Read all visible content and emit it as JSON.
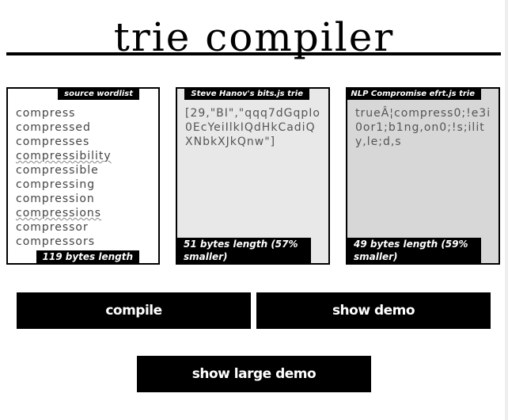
{
  "page": {
    "title": "trie compiler"
  },
  "panels": {
    "source": {
      "tag": "source wordlist",
      "words": [
        {
          "text": "compress"
        },
        {
          "text": "compressed"
        },
        {
          "text": "compresses"
        },
        {
          "text": "compressibility"
        },
        {
          "text": "compressible"
        },
        {
          "text": "compressing"
        },
        {
          "text": "compression"
        },
        {
          "text": "compressions"
        },
        {
          "text": "compressor"
        },
        {
          "text": "compressors"
        }
      ],
      "footer": "119 bytes length"
    },
    "bits": {
      "tag": "Steve Hanov's bits.js trie",
      "output": "[29,\"BI\",\"qqq7dGqpIo0EcYeiIlkIQdHkCadiQXNbkXJkQnw\"]",
      "footer": "51 bytes length (57% smaller)"
    },
    "efrt": {
      "tag": "NLP Compromise efrt.js trie",
      "output": "trueÂ¦compress0;!e3i0or1;b1ng,on0;!s;ility,le;d,s",
      "footer": "49 bytes length (59% smaller)"
    }
  },
  "buttons": {
    "compile": "compile",
    "show_demo": "show demo",
    "show_large_demo": "show large demo"
  }
}
